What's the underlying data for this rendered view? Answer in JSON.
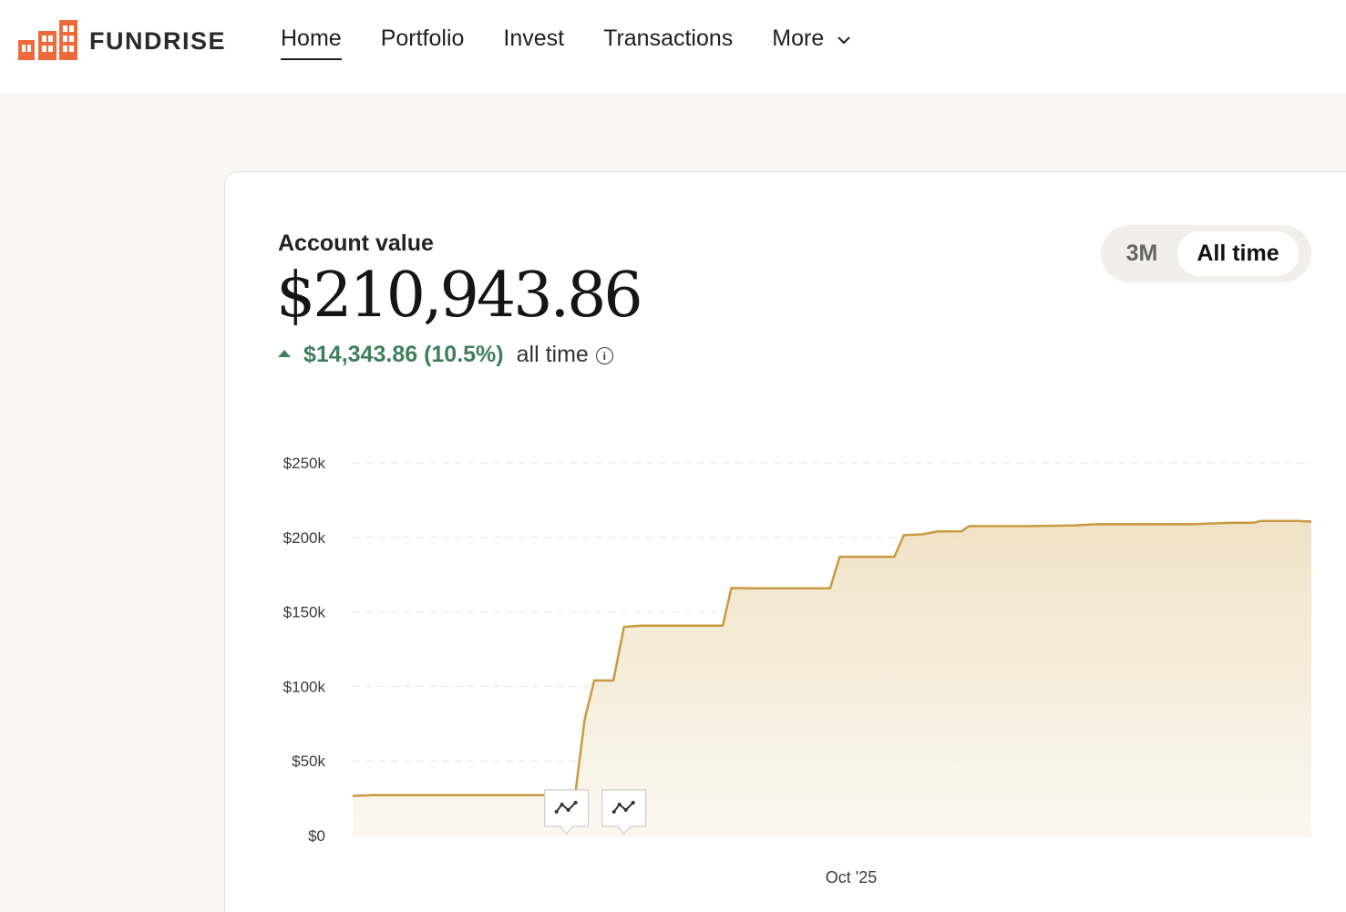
{
  "brand": {
    "name": "FUNDRISE",
    "logo_color": "#ee6a3a"
  },
  "nav": {
    "items": [
      {
        "label": "Home",
        "active": true
      },
      {
        "label": "Portfolio",
        "active": false
      },
      {
        "label": "Invest",
        "active": false
      },
      {
        "label": "Transactions",
        "active": false
      },
      {
        "label": "More",
        "active": false,
        "icon": "chevron-down-icon"
      }
    ]
  },
  "account": {
    "label": "Account value",
    "value": "$210,943.86",
    "change": "$14,343.86 (10.5%)",
    "change_direction": "up",
    "change_color": "#3f7f5c",
    "period": "all time",
    "info_icon": "info-icon"
  },
  "range": {
    "options": [
      "3M",
      "All time"
    ],
    "selected": "All time"
  },
  "chart_data": {
    "type": "area",
    "line_color": "#c99a3f",
    "fill_color": "#f2e6d0",
    "grid": "dashed horizontal",
    "ylim": [
      0,
      250000
    ],
    "y_ticks": [
      {
        "value": 250000,
        "label": "$250k"
      },
      {
        "value": 200000,
        "label": "$200k"
      },
      {
        "value": 150000,
        "label": "$150k"
      },
      {
        "value": 100000,
        "label": "$100k"
      },
      {
        "value": 50000,
        "label": "$50k"
      },
      {
        "value": 0,
        "label": "$0"
      }
    ],
    "x_ticks": [
      {
        "label": "Oct '25",
        "t": 0.52
      }
    ],
    "xlim": [
      0,
      1
    ],
    "points": [
      [
        0.0,
        26500
      ],
      [
        0.02,
        27000
      ],
      [
        0.2,
        27100
      ],
      [
        0.232,
        27100
      ],
      [
        0.242,
        78000
      ],
      [
        0.252,
        104000
      ],
      [
        0.272,
        104000
      ],
      [
        0.283,
        140000
      ],
      [
        0.3,
        140800
      ],
      [
        0.386,
        140800
      ],
      [
        0.395,
        166000
      ],
      [
        0.42,
        165800
      ],
      [
        0.498,
        165800
      ],
      [
        0.508,
        187000
      ],
      [
        0.565,
        187000
      ],
      [
        0.575,
        201500
      ],
      [
        0.594,
        202000
      ],
      [
        0.61,
        204000
      ],
      [
        0.635,
        204000
      ],
      [
        0.643,
        207500
      ],
      [
        0.7,
        207500
      ],
      [
        0.752,
        208000
      ],
      [
        0.775,
        208800
      ],
      [
        0.875,
        208800
      ],
      [
        0.918,
        209800
      ],
      [
        0.94,
        209800
      ],
      [
        0.947,
        211000
      ],
      [
        0.985,
        211000
      ],
      [
        1.0,
        210600
      ]
    ],
    "event_markers": [
      {
        "t": 0.223,
        "icon": "trend-icon"
      },
      {
        "t": 0.283,
        "icon": "trend-icon"
      }
    ]
  }
}
